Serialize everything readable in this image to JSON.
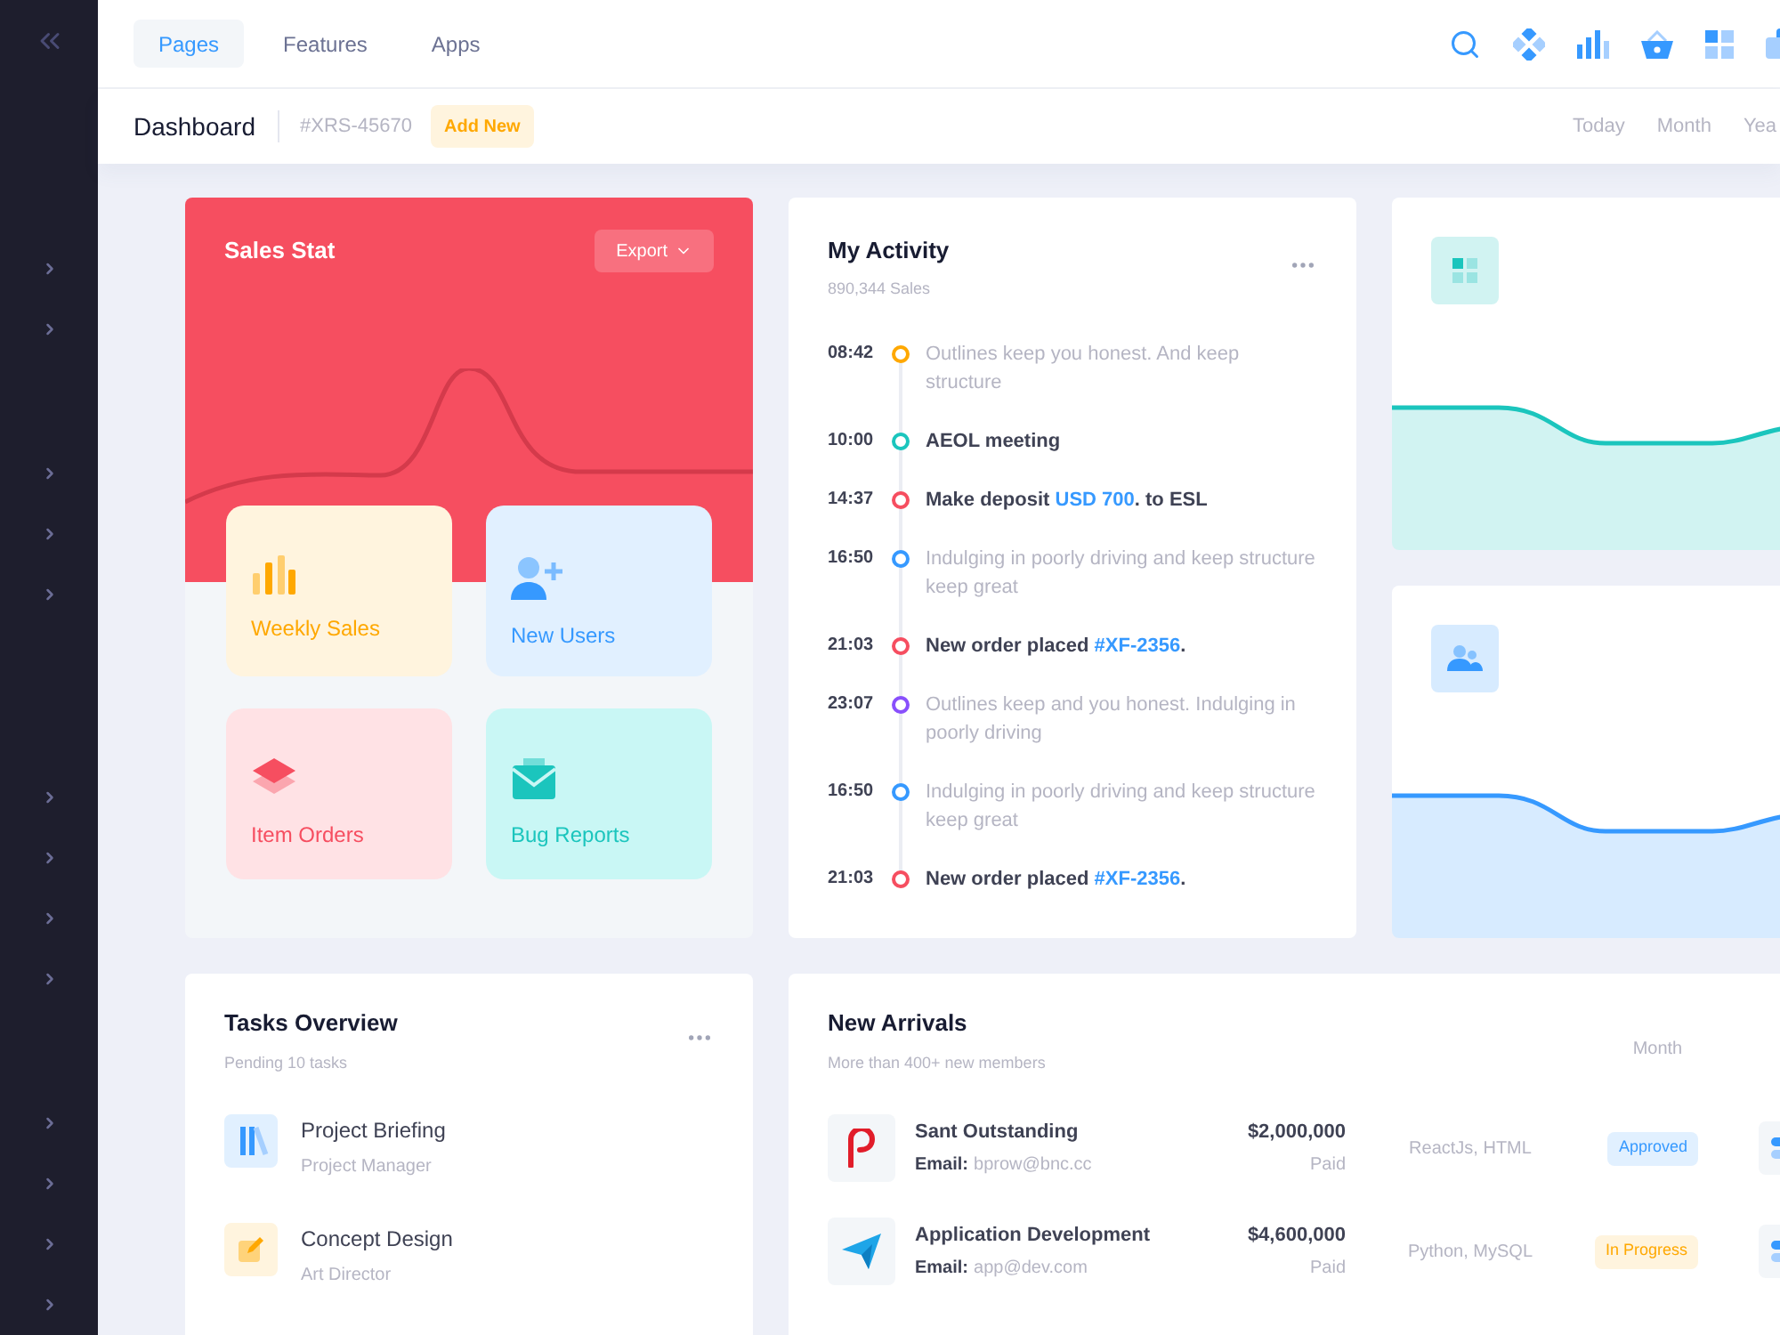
{
  "top_nav": {
    "tabs": [
      {
        "label": "Pages",
        "selected": true
      },
      {
        "label": "Features",
        "selected": false
      },
      {
        "label": "Apps",
        "selected": false
      }
    ]
  },
  "subheader": {
    "title": "Dashboard",
    "code": "#XRS-45670",
    "button": "Add New",
    "periods": [
      {
        "label": "Today",
        "selected": false
      },
      {
        "label": "Month",
        "selected": false
      },
      {
        "label": "Yea",
        "selected": false
      }
    ]
  },
  "sales_stat": {
    "title": "Sales Stat",
    "export": "Export",
    "tiles": [
      {
        "label": "Weekly Sales",
        "kind": "sales"
      },
      {
        "label": "New Users",
        "kind": "users"
      },
      {
        "label": "Item Orders",
        "kind": "orders"
      },
      {
        "label": "Bug Reports",
        "kind": "bugs"
      }
    ]
  },
  "activity": {
    "title": "My Activity",
    "subtitle": "890,344 Sales",
    "items": [
      {
        "time": "08:42",
        "color": "#ffa800",
        "kind": "note",
        "text": "Outlines keep you honest. And keep structure"
      },
      {
        "time": "10:00",
        "color": "#1bc5bd",
        "kind": "event",
        "text": "AEOL meeting"
      },
      {
        "time": "14:37",
        "color": "#f64e60",
        "kind": "event",
        "text": "Make deposit",
        "link": "USD 700",
        "after": ". to ESL"
      },
      {
        "time": "16:50",
        "color": "#3699ff",
        "kind": "note",
        "text": "Indulging in poorly driving and keep structure keep great"
      },
      {
        "time": "21:03",
        "color": "#f64e60",
        "kind": "event",
        "text": "New order placed",
        "link": "#XF-2356",
        "after": "."
      },
      {
        "time": "23:07",
        "color": "#8950fc",
        "kind": "note",
        "text": "Outlines keep and you honest. Indulging in poorly driving"
      },
      {
        "time": "16:50",
        "color": "#3699ff",
        "kind": "note",
        "text": "Indulging in poorly driving and keep structure keep great"
      },
      {
        "time": "21:03",
        "color": "#f64e60",
        "kind": "event",
        "text": "New order placed",
        "link": "#XF-2356",
        "after": "."
      }
    ]
  },
  "stat_cards": [
    {
      "kind": "grid",
      "color": "#1bc5bd"
    },
    {
      "kind": "users",
      "color": "#3699ff"
    }
  ],
  "tasks": {
    "title": "Tasks Overview",
    "subtitle": "Pending 10 tasks",
    "items": [
      {
        "title": "Project Briefing",
        "role": "Project Manager",
        "kind": "books"
      },
      {
        "title": "Concept Design",
        "role": "Art Director",
        "kind": "pen"
      }
    ]
  },
  "arrivals": {
    "title": "New Arrivals",
    "subtitle": "More than 400+ new members",
    "periods": [
      {
        "label": "Month",
        "selected": false
      }
    ],
    "rows": [
      {
        "kind": "p",
        "name": "Sant Outstanding",
        "email_label": "Email:",
        "email": "bprow@bnc.cc",
        "amount": "$2,000,000",
        "paid": "Paid",
        "tech": "ReactJs, HTML",
        "status": {
          "label": "Approved",
          "kind": "approved"
        }
      },
      {
        "kind": "plane",
        "name": "Application Development",
        "email_label": "Email:",
        "email": "app@dev.com",
        "amount": "$4,600,000",
        "paid": "Paid",
        "tech": "Python, MySQL",
        "status": {
          "label": "In Progress",
          "kind": "progress"
        }
      }
    ]
  }
}
